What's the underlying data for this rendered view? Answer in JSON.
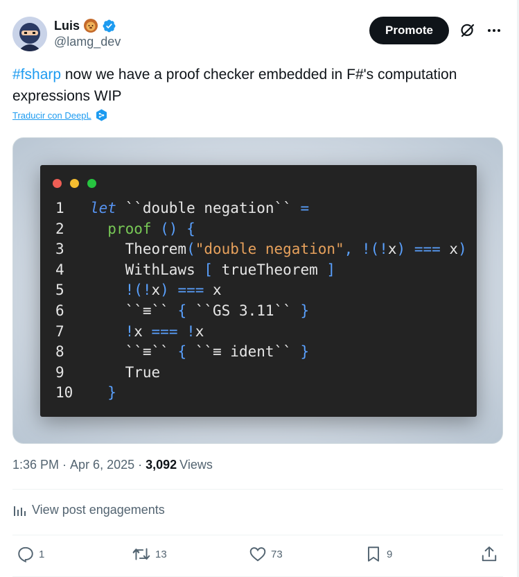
{
  "author": {
    "display_name": "Luis",
    "handle": "@lamg_dev",
    "emoji": "lion-face",
    "verified": true
  },
  "header": {
    "promote_label": "Promote",
    "grok_icon": "grok-icon",
    "more_icon": "more-icon"
  },
  "post": {
    "hashtag": "#fsharp",
    "text": " now we have a proof checker embedded in F#'s computation expressions WIP",
    "translate_label": "Traducir con DeepL"
  },
  "code_image": {
    "window_dots": [
      "#ee5e55",
      "#f4bd30",
      "#27c440"
    ],
    "lines": [
      {
        "n": "1",
        "tokens": [
          {
            "t": "let",
            "c": "kw"
          },
          {
            "t": " ``double negation`` ",
            "c": "white"
          },
          {
            "t": "=",
            "c": "blue"
          }
        ]
      },
      {
        "n": "2",
        "tokens": [
          {
            "t": "  ",
            "c": "white"
          },
          {
            "t": "proof",
            "c": "green"
          },
          {
            "t": " () {",
            "c": "blue"
          }
        ]
      },
      {
        "n": "3",
        "tokens": [
          {
            "t": "    Theorem",
            "c": "white"
          },
          {
            "t": "(",
            "c": "blue"
          },
          {
            "t": "\"double negation\"",
            "c": "str"
          },
          {
            "t": ", !(!",
            "c": "blue"
          },
          {
            "t": "x",
            "c": "white"
          },
          {
            "t": ") ",
            "c": "blue"
          },
          {
            "t": "===",
            "c": "blue"
          },
          {
            "t": " x",
            "c": "white"
          },
          {
            "t": ")",
            "c": "blue"
          }
        ]
      },
      {
        "n": "4",
        "tokens": [
          {
            "t": "    WithLaws ",
            "c": "white"
          },
          {
            "t": "[",
            "c": "blue"
          },
          {
            "t": " trueTheorem ",
            "c": "white"
          },
          {
            "t": "]",
            "c": "blue"
          }
        ]
      },
      {
        "n": "5",
        "tokens": [
          {
            "t": "    ",
            "c": "white"
          },
          {
            "t": "!(!",
            "c": "blue"
          },
          {
            "t": "x",
            "c": "white"
          },
          {
            "t": ") ",
            "c": "blue"
          },
          {
            "t": "===",
            "c": "blue"
          },
          {
            "t": " x",
            "c": "white"
          }
        ]
      },
      {
        "n": "6",
        "tokens": [
          {
            "t": "    ``≡`` ",
            "c": "white"
          },
          {
            "t": "{",
            "c": "blue"
          },
          {
            "t": " ``GS 3.11`` ",
            "c": "white"
          },
          {
            "t": "}",
            "c": "blue"
          }
        ]
      },
      {
        "n": "7",
        "tokens": [
          {
            "t": "    ",
            "c": "white"
          },
          {
            "t": "!",
            "c": "blue"
          },
          {
            "t": "x ",
            "c": "white"
          },
          {
            "t": "===",
            "c": "blue"
          },
          {
            "t": " ",
            "c": "white"
          },
          {
            "t": "!",
            "c": "blue"
          },
          {
            "t": "x",
            "c": "white"
          }
        ]
      },
      {
        "n": "8",
        "tokens": [
          {
            "t": "    ``≡`` ",
            "c": "white"
          },
          {
            "t": "{",
            "c": "blue"
          },
          {
            "t": " ``≡ ident`` ",
            "c": "white"
          },
          {
            "t": "}",
            "c": "blue"
          }
        ]
      },
      {
        "n": "9",
        "tokens": [
          {
            "t": "    True",
            "c": "white"
          }
        ]
      },
      {
        "n": "10",
        "tokens": [
          {
            "t": "  ",
            "c": "white"
          },
          {
            "t": "}",
            "c": "blue"
          }
        ]
      }
    ]
  },
  "meta": {
    "time": "1:36 PM",
    "sep1": " · ",
    "date": "Apr 6, 2025",
    "sep2": " · ",
    "views_count": "3,092",
    "views_label": "Views"
  },
  "engagements_label": "View post engagements",
  "actions": {
    "replies": "1",
    "reposts": "13",
    "likes": "73",
    "bookmarks": "9"
  },
  "colors": {
    "accent": "#1d9bf0",
    "text_primary": "#0f1419",
    "text_secondary": "#536471",
    "verified": "#1d9bf0"
  }
}
